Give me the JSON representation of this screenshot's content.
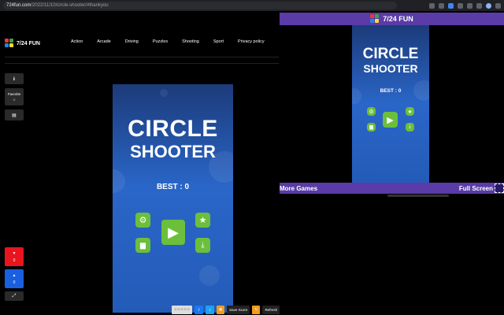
{
  "browser": {
    "url_host": "724fun.com",
    "url_path": "/2022/11/10/circle-shooter/#thankyou"
  },
  "site": {
    "logo_text": "7/24 FUN",
    "nav": [
      "Action",
      "Arcade",
      "Driving",
      "Puzzles",
      "Shooting",
      "Sport",
      "Privacy policy"
    ],
    "sidebar": {
      "info_icon": "info-icon",
      "favorite_label": "Favorite",
      "favorite_icon": "star-icon",
      "comment_icon": "comment-icon",
      "dislike_count": "0",
      "like_count": "0",
      "fullscreen_icon": "expand-icon"
    },
    "game": {
      "title_line1": "CIRCLE",
      "title_line2": "SHOOTER",
      "best": "BEST : 0"
    },
    "bottom": {
      "stars": "☆☆☆☆☆",
      "fb": "f",
      "tw": "t",
      "save_score": "Save Score",
      "refresh": "Refresh",
      "next_game": "Next Game"
    }
  },
  "panel": {
    "title": "7/24 FUN",
    "game": {
      "title_line1": "CIRCLE",
      "title_line2": "SHOOTER",
      "best": "BEST : 0"
    },
    "more_games": "More Games",
    "full_screen": "Full Screen"
  },
  "colors": {
    "accent_purple": "#5a3ba8",
    "game_green": "#6bbf3b",
    "dislike_red": "#e8141e",
    "like_blue": "#1a5fe0",
    "orange": "#f39a1e"
  }
}
